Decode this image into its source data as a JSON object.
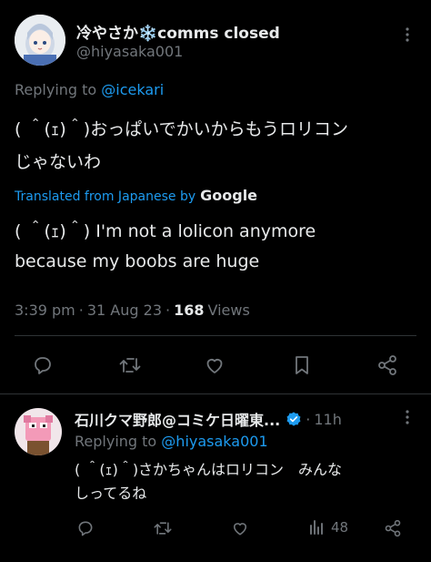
{
  "main_tweet": {
    "display_name": "冷やさか❄️comms closed",
    "handle": "@hiyasaka001",
    "reply_prefix": "Replying to",
    "reply_to": "@icekari",
    "text_line1": "( ＾(ｪ)＾)おっぱいでかいからもうロリコン",
    "text_line2": "じゃないわ",
    "translated_label": "Translated from Japanese by",
    "translated_brand": "Google",
    "translation_line1": "( ＾(ｪ)＾) I'm not a lolicon anymore",
    "translation_line2": "because my boobs are huge",
    "time": "3:39 pm",
    "date": "31 Aug 23",
    "views_count": "168",
    "views_label": "Views",
    "sep": "·"
  },
  "reply_tweet": {
    "display_name": "石川クマ野郎@コミケ日曜東...",
    "age": "11h",
    "sep": "·",
    "reply_prefix": "Replying to",
    "reply_to": "@hiyasaka001",
    "text_line1": "( ＾(ｪ)＾)さかちゃんはロリコン　みんな",
    "text_line2": "しってるね",
    "views_count": "48"
  },
  "colors": {
    "background": "#000000",
    "text": "#e7e9ea",
    "muted": "#71767b",
    "accent": "#1d9bf0",
    "divider": "#2f3336"
  },
  "icons": [
    "more-icon",
    "reply-icon",
    "retweet-icon",
    "like-icon",
    "bookmark-icon",
    "share-icon",
    "verified-icon",
    "views-icon"
  ]
}
